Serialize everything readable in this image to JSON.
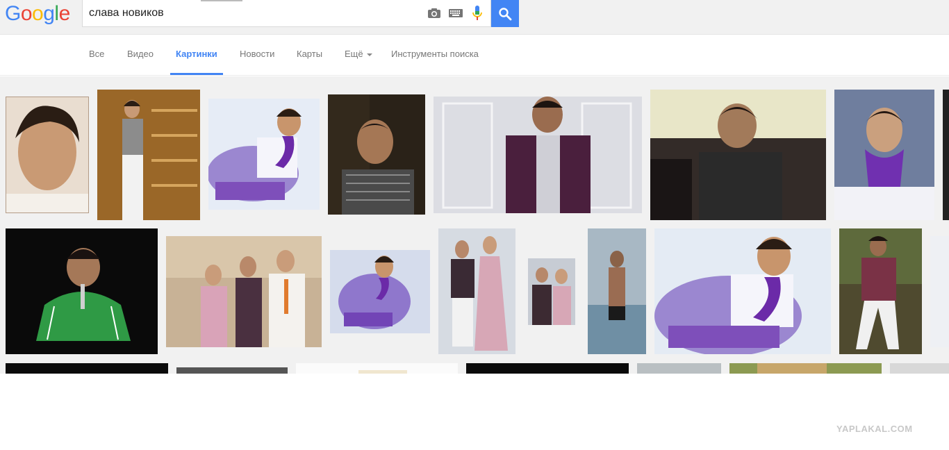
{
  "logo": {
    "letters": [
      "G",
      "o",
      "o",
      "g",
      "l",
      "e"
    ],
    "colors": [
      "#4285f4",
      "#ea4335",
      "#fbbc05",
      "#4285f4",
      "#34a853",
      "#ea4335"
    ]
  },
  "search": {
    "query": "слава новиков"
  },
  "icons": {
    "camera": "camera-icon",
    "keyboard": "keyboard-icon",
    "mic": "mic-icon",
    "search": "search-icon"
  },
  "tabs": [
    {
      "label": "Все"
    },
    {
      "label": "Видео"
    },
    {
      "label": "Картинки",
      "active": true
    },
    {
      "label": "Новости"
    },
    {
      "label": "Карты"
    },
    {
      "label": "Ещё"
    },
    {
      "label": "Инструменты поиска"
    }
  ],
  "accent_color": "#4285f4",
  "watermark": "YAPLAKAL.COM",
  "results": {
    "thumbnails": [
      "Closeup portrait of young man with dark hair",
      "Young man in vest standing by wooden shelves",
      "Young man with purple scarf on purple armchair",
      "Young man in striped shirt, dark background",
      "Young man in purple blazer in white room",
      "Young man in dark shirt sitting on couch",
      "Young man with purple scarf seated, blue background",
      "Young man in green tracksuit with microphone",
      "Group: young woman, young man, man in white suit",
      "Young man with purple scarf on purple armchair",
      "Young man and girl in floral outfits",
      "Young man and girl in floral outfits, small",
      "Shirtless young man standing in sea",
      "Young man with purple scarf on purple armchair, wide",
      "Young man in floral shirt and white pants outdoors"
    ]
  }
}
